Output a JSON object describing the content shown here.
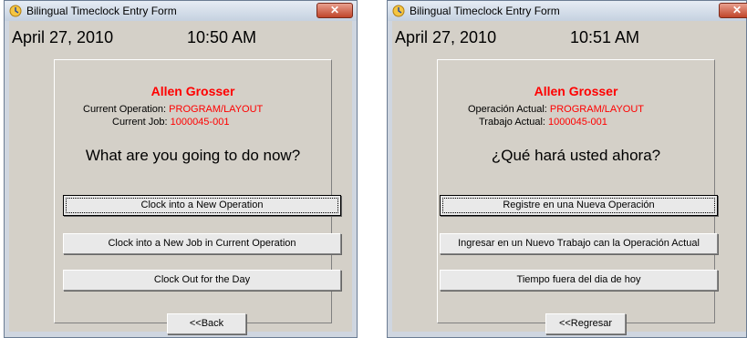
{
  "windows": [
    {
      "title": "Bilingual Timeclock Entry Form",
      "close_label": "✕",
      "date": "April 27, 2010",
      "time": "10:50 AM",
      "employee_name": "Allen Grosser",
      "operation_label": "Current Operation:",
      "operation_value": "PROGRAM/LAYOUT",
      "job_label": "Current Job:",
      "job_value": "1000045-001",
      "question": "What are you going to do now?",
      "buttons": {
        "new_operation": "Clock into a New Operation",
        "new_job": "Clock into a New Job in Current Operation",
        "clock_out": "Clock Out for the Day",
        "back": "<<Back"
      }
    },
    {
      "title": "Bilingual Timeclock Entry Form",
      "close_label": "✕",
      "date": "April 27, 2010",
      "time": "10:51 AM",
      "employee_name": "Allen Grosser",
      "operation_label": "Operación Actual:",
      "operation_value": "PROGRAM/LAYOUT",
      "job_label": "Trabajo Actual:",
      "job_value": "1000045-001",
      "question": "¿Qué hará usted ahora?",
      "buttons": {
        "new_operation": "Registre en una Nueva Operación",
        "new_job": "Ingresar en un Nuevo Trabajo can la Operación Actual",
        "clock_out": "Tiempo fuera del dia de hoy",
        "back": "<<Regresar"
      }
    }
  ],
  "colors": {
    "accent_red": "#ff0000",
    "client_gray": "#d4d0c8"
  },
  "icons": {
    "app": "clock-app-icon",
    "close": "close-icon"
  }
}
